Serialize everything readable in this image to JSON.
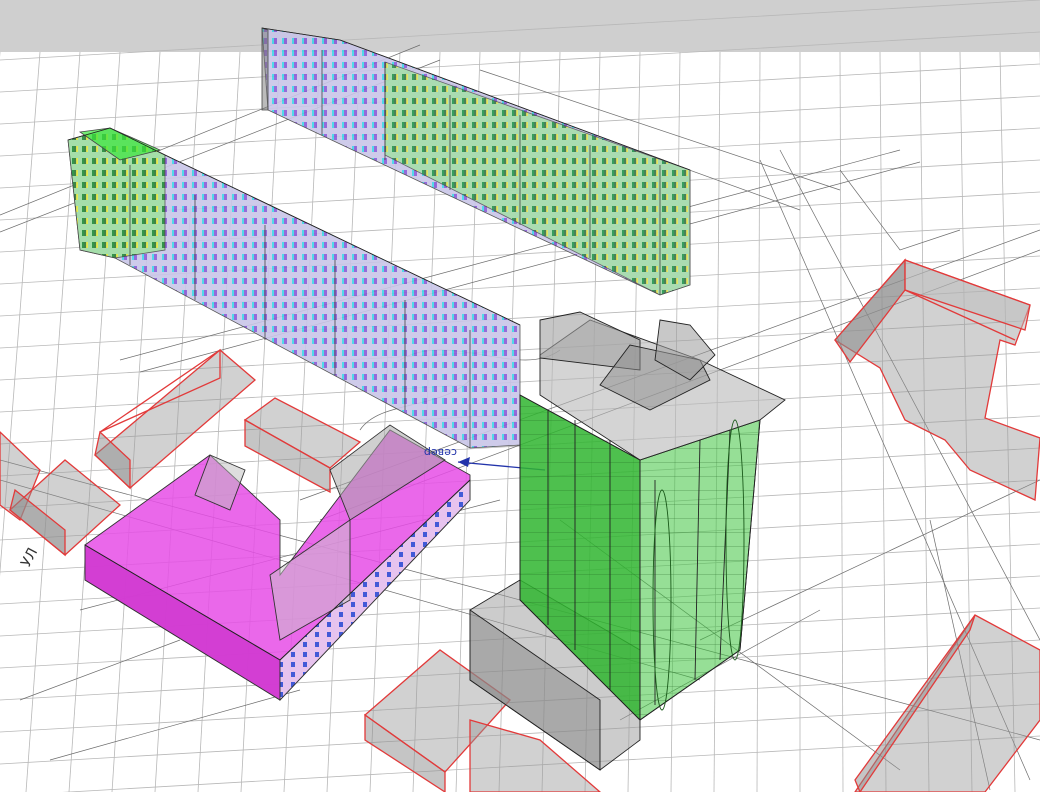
{
  "scene": {
    "background": "#ffffff",
    "top_band_color": "#cfcfcf",
    "grid_color": "#b8b8b8",
    "survey_line_color": "#6c6c6c",
    "labels": {
      "insolation_arrow": "север",
      "street_left": "УЛ"
    },
    "colors": {
      "existing_outline": "#e23a3a",
      "existing_fill": "#9a9a9a",
      "designed_tower": "#2fb52f",
      "shaded_building": "#e64ee6",
      "lit_facade": "#33e633",
      "window_violet": "#8a5ad6",
      "window_cyan": "#3fd6e6",
      "arrow": "#2233aa"
    }
  }
}
